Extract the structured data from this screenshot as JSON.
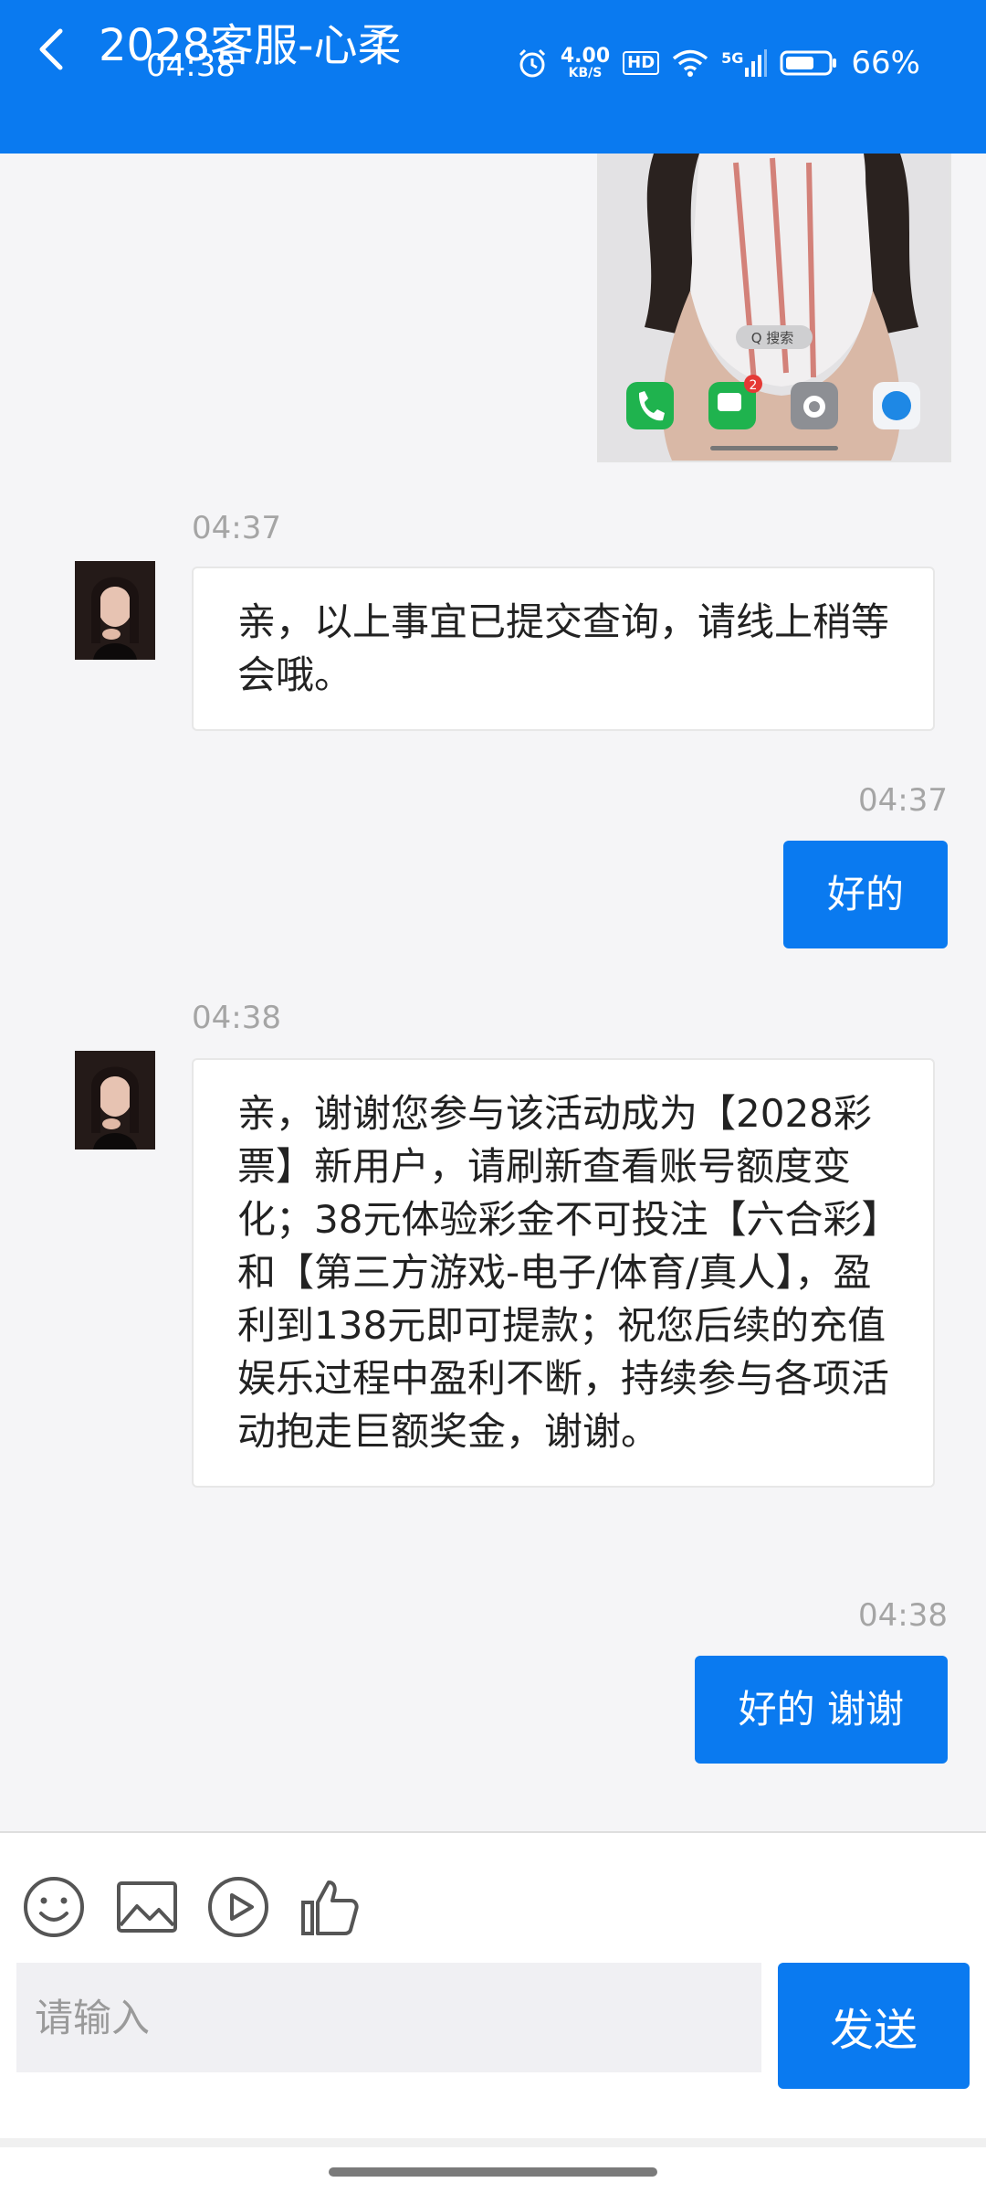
{
  "header": {
    "title": "2028客服-心柔",
    "time": "04:38",
    "battery": "66%",
    "net_speed_value": "4.00",
    "net_speed_unit": "KB/S",
    "hd": "HD",
    "network": "5G",
    "background_color": "#0a7af0"
  },
  "image_message": {
    "search_label": "Q 搜索",
    "badge_count": "2"
  },
  "messages": [
    {
      "side": "left",
      "time": "04:37",
      "text": "亲，以上事宜已提交查询，请线上稍等会哦。"
    },
    {
      "side": "right",
      "time": "04:37",
      "text": "好的"
    },
    {
      "side": "left",
      "time": "04:38",
      "text": "亲，谢谢您参与该活动成为【2028彩票】新用户，请刷新查看账号额度变化；38元体验彩金不可投注【六合彩】和【第三方游戏-电子/体育/真人】，盈利到138元即可提款；祝您后续的充值娱乐过程中盈利不断，持续参与各项活动抱走巨额奖金，谢谢。"
    },
    {
      "side": "right",
      "time": "04:38",
      "text": "好的 谢谢"
    }
  ],
  "composer": {
    "placeholder": "请输入",
    "send_label": "发送",
    "tools": [
      "emoji-icon",
      "image-icon",
      "video-icon",
      "thumbs-up-icon"
    ]
  },
  "colors": {
    "accent": "#0a7af0",
    "chat_background": "#f5f5f7",
    "timestamp": "#a5a5a5"
  }
}
